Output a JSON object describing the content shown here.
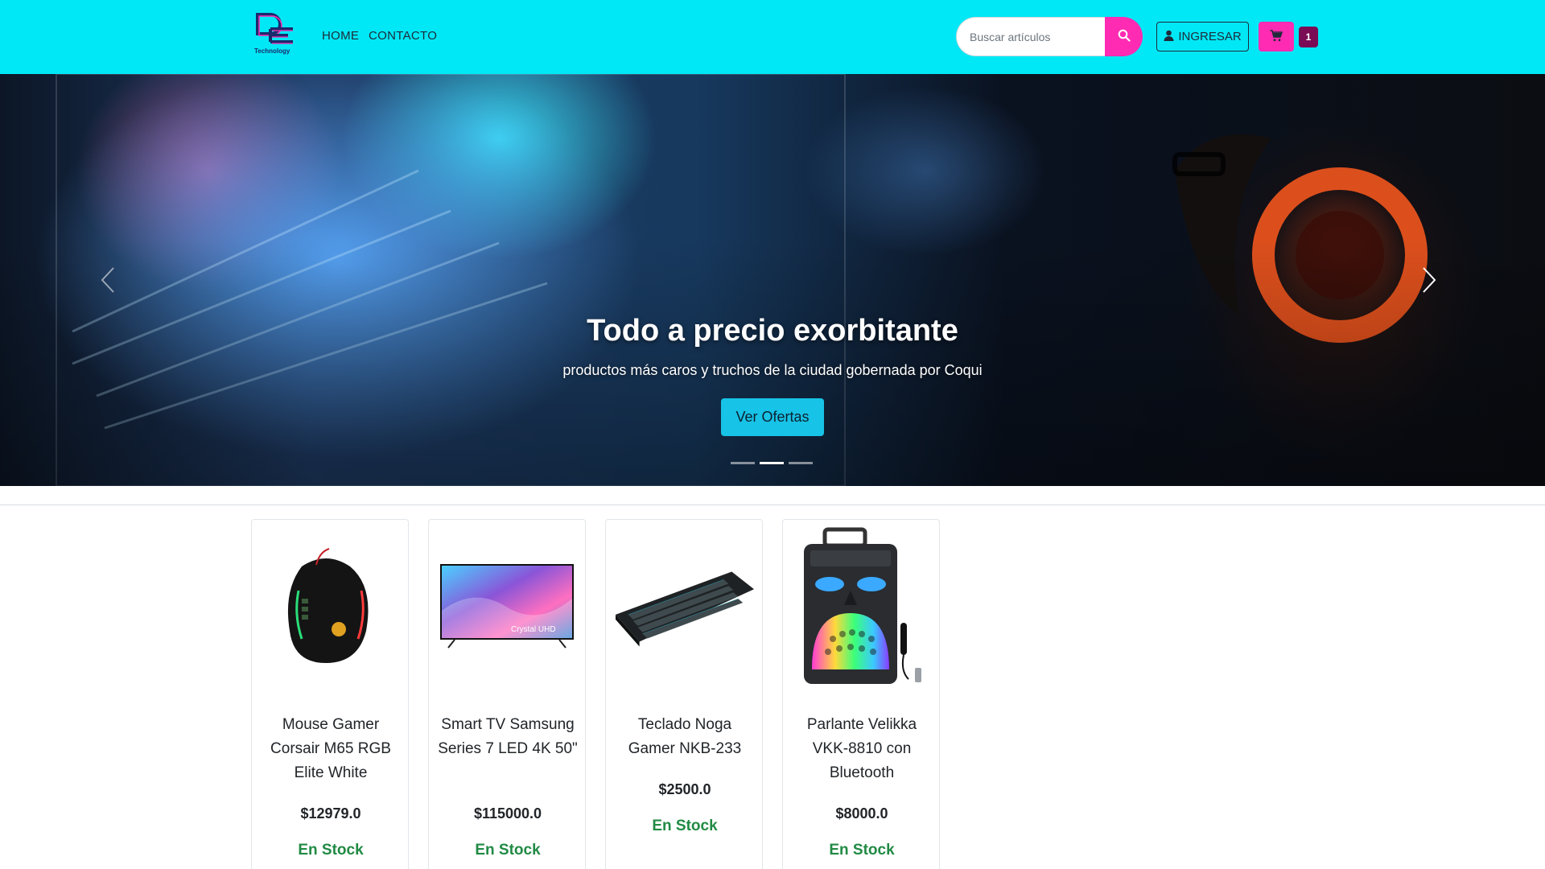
{
  "nav": {
    "logo_text": "Technology",
    "home": "HOME",
    "contact": "CONTACTO"
  },
  "search": {
    "placeholder": "Buscar artículos"
  },
  "header": {
    "login_label": "INGRESAR",
    "cart_count": "1"
  },
  "hero": {
    "title": "Todo a precio exorbitante",
    "subtitle": "productos más caros y truchos de la ciudad gobernada por Coqui",
    "cta": "Ver Ofertas",
    "slides": 3,
    "active_slide": 2
  },
  "products": [
    {
      "name": "Mouse Gamer Corsair M65 RGB Elite White",
      "price": "$12979.0",
      "stock": "En Stock",
      "image_icon": "mouse-image"
    },
    {
      "name": "Smart TV Samsung Series 7 LED 4K 50\"",
      "price": "$115000.0",
      "stock": "En Stock",
      "image_icon": "tv-image",
      "image_label": "Crystal UHD"
    },
    {
      "name": "Teclado Noga Gamer NKB-233",
      "price": "$2500.0",
      "stock": "En Stock",
      "image_icon": "keyboard-image"
    },
    {
      "name": "Parlante Velikka VKK-8810 con Bluetooth",
      "price": "$8000.0",
      "stock": "En Stock",
      "image_icon": "speaker-image"
    }
  ],
  "colors": {
    "navbar": "#00e8f5",
    "accent": "#ff2bb3",
    "badge": "#7a0b55",
    "cta": "#17c3e6",
    "stock": "#218a44"
  }
}
